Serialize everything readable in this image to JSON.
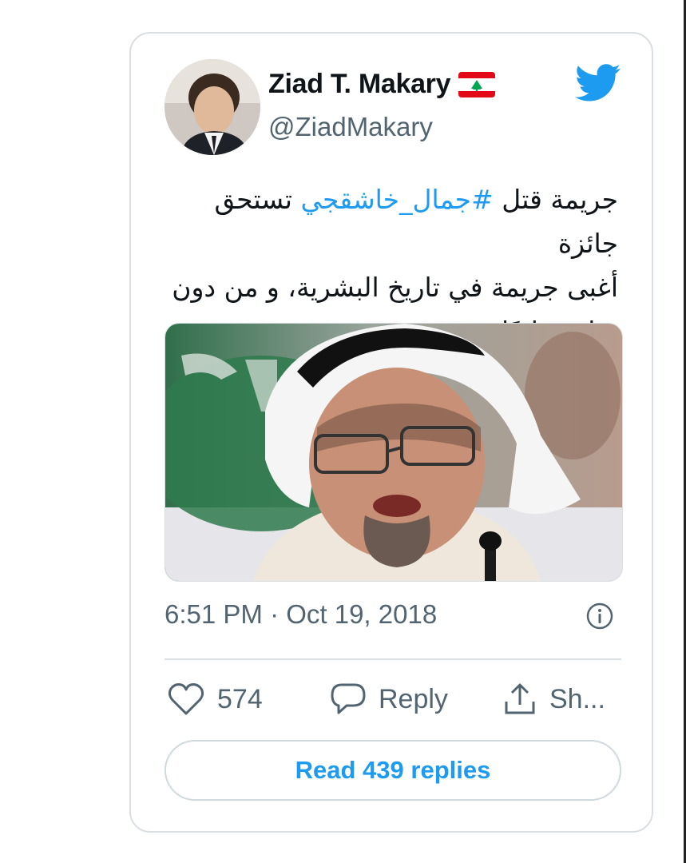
{
  "tweet": {
    "author": {
      "display_name": "Ziad T. Makary",
      "handle": "@ZiadMakary",
      "flag_icon": "lebanon-flag-icon"
    },
    "text": {
      "line1_before": "جريمة قتل ",
      "hashtag": "#جمال_خاشقجي",
      "line1_after": " تستحق جائزة",
      "line2": "أغبى جريمة في تاريخ البشرية، و من دون",
      "line3": "منازع طبعًا"
    },
    "timestamp": "6:51 PM · Oct 19, 2018",
    "actions": {
      "like_count": "574",
      "reply_label": "Reply",
      "share_label": "Sh..."
    },
    "read_replies_label": "Read 439 replies"
  },
  "colors": {
    "accent": "#1d9bf0",
    "text_primary": "#0f1419",
    "text_secondary": "#536471",
    "border": "#d9dee2",
    "flag_red": "#e30a17",
    "flag_cedar": "#00a651"
  },
  "icons": [
    "twitter-bird-icon",
    "info-icon",
    "heart-icon",
    "reply-bubble-icon",
    "share-icon"
  ]
}
